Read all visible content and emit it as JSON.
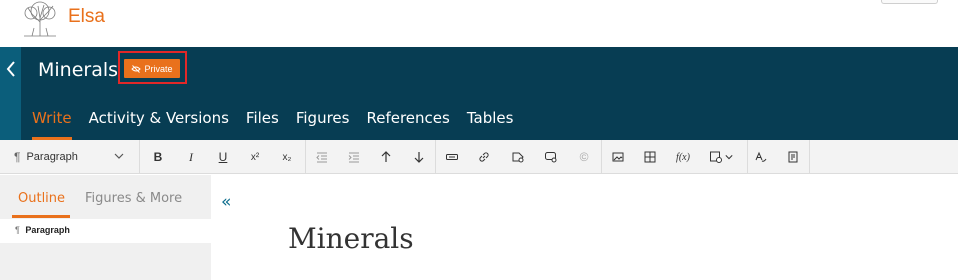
{
  "brand": {
    "name": "Elsa"
  },
  "header": {
    "title": "Minerals",
    "badge": "Private",
    "tabs": [
      "Write",
      "Activity & Versions",
      "Files",
      "Figures",
      "References",
      "Tables"
    ],
    "active_tab": "Write"
  },
  "toolbar": {
    "paragraph_style": "Paragraph",
    "icons": [
      "bold-icon",
      "italic-icon",
      "underline-icon",
      "superscript-icon",
      "subscript-icon",
      "decrease-indent-icon",
      "increase-indent-icon",
      "move-up-icon",
      "move-down-icon",
      "footnote-icon",
      "link-icon",
      "tag-icon",
      "comment-icon",
      "copyright-icon",
      "image-icon",
      "table-icon",
      "formula-icon",
      "insert-icon",
      "spellcheck-icon",
      "notes-icon"
    ],
    "bold": "B",
    "italic": "I",
    "underline": "U",
    "superscript": "x²",
    "subscript": "x₂",
    "copyright": "©",
    "formula": "f(x)"
  },
  "left_panel": {
    "tabs": [
      "Outline",
      "Figures & More"
    ],
    "active_tab": "Outline",
    "outline_items": [
      "Paragraph"
    ]
  },
  "editor": {
    "title": "Minerals"
  },
  "colors": {
    "accent": "#e9711c",
    "header_bg": "#073d53",
    "back_strip": "#0b5e7b",
    "highlight_frame": "#e12828"
  }
}
